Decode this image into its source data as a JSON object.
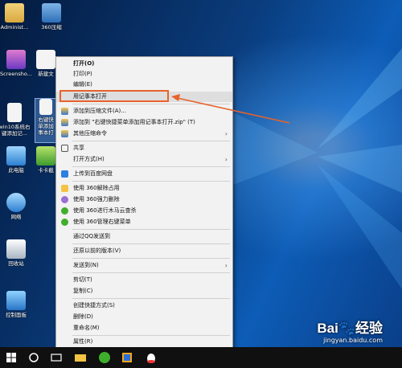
{
  "desktop": {
    "icons": [
      {
        "id": "admin",
        "label": "Administ..."
      },
      {
        "id": "compress",
        "label": "360压缩"
      },
      {
        "id": "screenshot",
        "label": "Screensho..."
      },
      {
        "id": "newdoc",
        "label": "新建文"
      },
      {
        "id": "win10",
        "label": "win10系统右",
        "label2": "键添加记..."
      },
      {
        "id": "rightkey",
        "label": "右键快",
        "label2": "单添加",
        "label3": "事本打"
      },
      {
        "id": "pc",
        "label": "此电脑"
      },
      {
        "id": "card",
        "label": "卡卡截"
      },
      {
        "id": "network",
        "label": "网络"
      },
      {
        "id": "recycle",
        "label": "回收站"
      },
      {
        "id": "control",
        "label": "控制面板"
      }
    ]
  },
  "context_menu": {
    "items": [
      {
        "label": "打开(O)",
        "bold": true
      },
      {
        "label": "打印(P)"
      },
      {
        "label": "编辑(E)"
      },
      {
        "label": "用记事本打开",
        "highlighted": true
      },
      {
        "label": "添加到压缩文件(A)..."
      },
      {
        "label": "添加到 \"右键快捷菜单添加用记事本打开.zip\" (T)"
      },
      {
        "label": "其他压缩命令",
        "submenu": true
      },
      {
        "label": "共享"
      },
      {
        "label": "打开方式(H)",
        "submenu": true
      },
      {
        "label": "上传到百度网盘"
      },
      {
        "label": "使用 360解除占用"
      },
      {
        "label": "使用 360强力删除"
      },
      {
        "label": "使用 360进行木马云查杀"
      },
      {
        "label": "使用 360管理右键菜单"
      },
      {
        "label": "通过QQ发送到"
      },
      {
        "label": "还原以前的版本(V)"
      },
      {
        "label": "发送到(N)",
        "submenu": true
      },
      {
        "label": "剪切(T)"
      },
      {
        "label": "复制(C)"
      },
      {
        "label": "创建快捷方式(S)"
      },
      {
        "label": "删除(D)"
      },
      {
        "label": "重命名(M)"
      },
      {
        "label": "属性(R)"
      }
    ]
  },
  "watermark": {
    "brand": "Bai🐾经验",
    "site": "jingyan.baidu.com"
  },
  "colors": {
    "annotation": "#e8622c",
    "menu_bg": "#f2f2f2",
    "taskbar": "#101010"
  }
}
